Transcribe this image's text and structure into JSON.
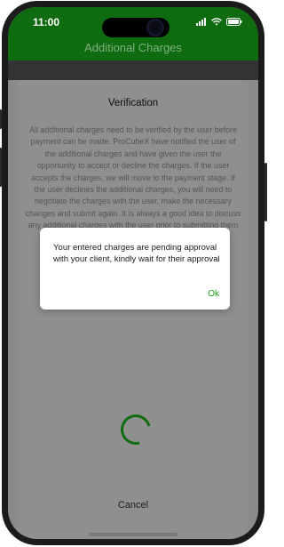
{
  "status_bar": {
    "time": "11:00",
    "icons": [
      "signal-icon",
      "wifi-icon",
      "battery-icon"
    ]
  },
  "header": {
    "title": "Additional Charges"
  },
  "verification": {
    "title": "Verification",
    "body": "All additional charges need to be verified by the user before payment can be made. ProCubeX have notified the user of the additional charges and have given the user the opportunity to accept or decline the charges. If the user accepts the charges, we will move to the payment stage. If the user declines the additional charges, you will need to negotiate the charges with the user, make the necessary changes and submit again. It is always a good idea to discuss any additional charges with the user prior to submitting them to avoid unnecessary delays in payment.",
    "cancel_label": "Cancel"
  },
  "dialog": {
    "message": "Your entered charges are pending approval with your client, kindly wait for their approval",
    "ok_label": "Ok"
  },
  "colors": {
    "brand_green": "#0f6b0f",
    "ok_green": "#1f9a1f",
    "overlay_gray": "#8a8a8a"
  }
}
